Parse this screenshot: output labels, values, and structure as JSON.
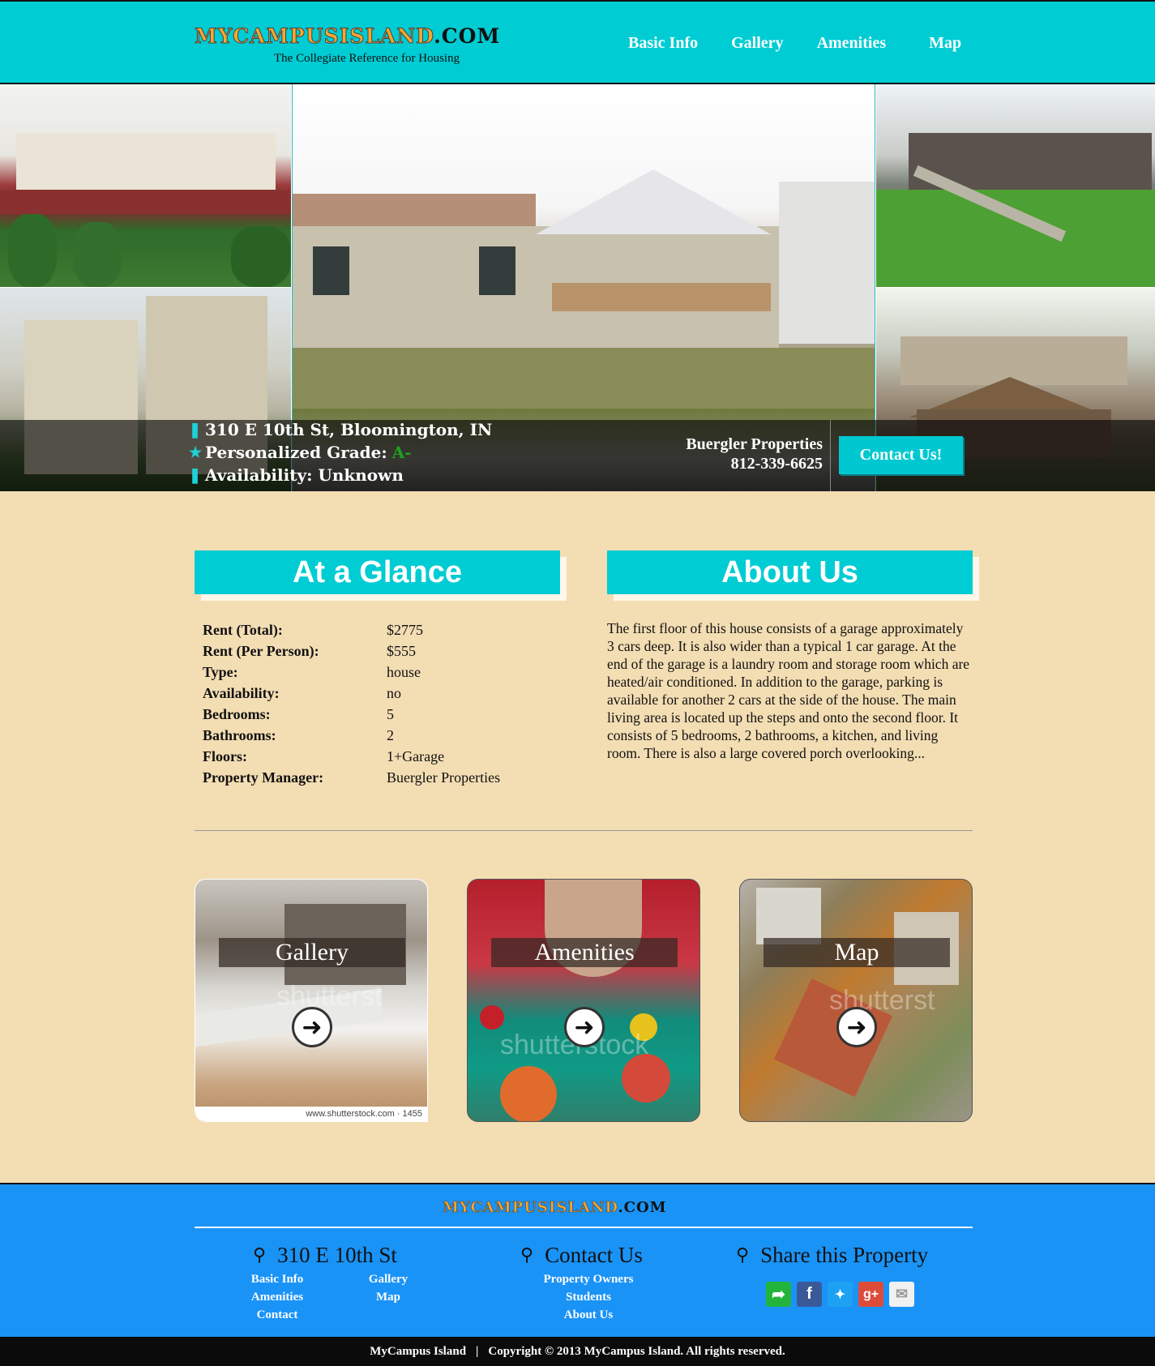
{
  "header": {
    "logo_main": "MYCAMPUSISLAND",
    "logo_suffix": ".COM",
    "tagline": "The Collegiate Reference for Housing",
    "nav": [
      "Basic Info",
      "Gallery",
      "Amenities",
      "Map"
    ]
  },
  "hero": {
    "address": "310 E 10th St, Bloomington, IN",
    "grade_label": "Personalized Grade:",
    "grade_value": "A-",
    "availability": "Availability: Unknown",
    "manager_name": "Buergler Properties",
    "manager_phone": "812-339-6625",
    "contact_button": "Contact Us!"
  },
  "glance": {
    "title": "At a Glance",
    "rows": [
      {
        "label": "Rent (Total):",
        "value": "$2775"
      },
      {
        "label": "Rent (Per Person):",
        "value": "$555"
      },
      {
        "label": "Type:",
        "value": "house"
      },
      {
        "label": "Availability:",
        "value": "no"
      },
      {
        "label": "Bedrooms:",
        "value": "5"
      },
      {
        "label": "Bathrooms:",
        "value": "2"
      },
      {
        "label": "Floors:",
        "value": "1+Garage"
      },
      {
        "label": "Property Manager:",
        "value": "Buergler Properties"
      }
    ]
  },
  "about": {
    "title": "About Us",
    "text": "The first floor of this house consists of a garage approximately 3 cars deep. It is also wider than a typical 1 car garage. At the end of the garage is a laundry room and storage room which are heated/air conditioned. In addition to the garage, parking is available for another 2 cars at the side of the house. The main living area is located up the steps and onto the second floor. It consists of 5 bedrooms, 2 bathrooms, a kitchen, and living room. There is also a large covered porch overlooking..."
  },
  "cards": [
    {
      "label": "Gallery",
      "caption": "www.shutterstock.com · 1455"
    },
    {
      "label": "Amenities"
    },
    {
      "label": "Map"
    }
  ],
  "footer": {
    "logo_main": "MYCAMPUSISLAND",
    "logo_suffix": ".COM",
    "col1_title": "310 E 10th St",
    "col1_links": [
      "Basic Info",
      "Gallery",
      "Amenities",
      "Map",
      "Contact"
    ],
    "col2_title": "Contact Us",
    "col2_links": [
      "Property Owners",
      "Students",
      "About Us"
    ],
    "col3_title": "Share this Property",
    "share_icons": [
      "share-icon",
      "facebook-icon",
      "twitter-icon",
      "google-plus-icon",
      "email-icon"
    ]
  },
  "bottom_bar": {
    "site": "MyCampus Island",
    "separator": "|",
    "copyright": "Copyright © 2013 MyCampus Island. All rights reserved."
  },
  "colors": {
    "accent_teal": "#00ccd3",
    "footer_blue": "#1a93f7",
    "background_tan": "#f3ddb3",
    "grade_green": "#1ea21e"
  }
}
